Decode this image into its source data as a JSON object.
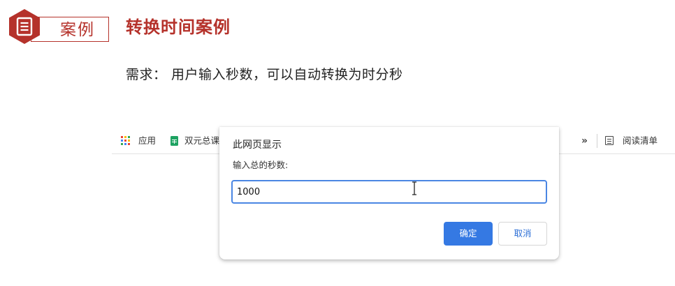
{
  "slide": {
    "badge_label": "案例",
    "title": "转换时间案例",
    "requirement": "需求： 用户输入秒数，可以自动转换为时分秒"
  },
  "bookmarks": {
    "items": [
      {
        "label": "应用",
        "icon": "apps-grid-icon"
      },
      {
        "label": "双元总课",
        "icon": "sheets-icon"
      }
    ],
    "more_label": "»",
    "reading_list_label": "阅读清单"
  },
  "dialog": {
    "title": "此网页显示",
    "message": "输入总的秒数:",
    "input_value": "1000",
    "ok_label": "确定",
    "cancel_label": "取消"
  },
  "colors": {
    "accent_red": "#b5322b",
    "primary_blue": "#3579e3",
    "input_border": "#4a86e3"
  }
}
